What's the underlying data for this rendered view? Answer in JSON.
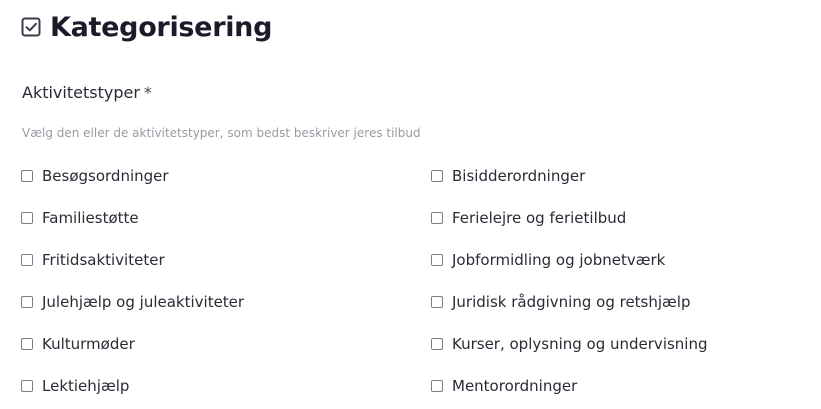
{
  "header": {
    "title": "Kategorisering",
    "icon": "checkbox-checked-icon"
  },
  "field": {
    "label": "Aktivitetstyper",
    "required_mark": "*",
    "helper": "Vælg den eller de aktivitetstyper, som bedst beskriver jeres tilbud"
  },
  "options": {
    "left": [
      {
        "label": "Besøgsordninger",
        "checked": false
      },
      {
        "label": "Familiestøtte",
        "checked": false
      },
      {
        "label": "Fritidsaktiviteter",
        "checked": false
      },
      {
        "label": "Julehjælp og juleaktiviteter",
        "checked": false
      },
      {
        "label": "Kulturmøder",
        "checked": false
      },
      {
        "label": "Lektiehjælp",
        "checked": false
      }
    ],
    "right": [
      {
        "label": "Bisidderordninger",
        "checked": false
      },
      {
        "label": "Ferielejre og ferietilbud",
        "checked": false
      },
      {
        "label": "Jobformidling og jobnetværk",
        "checked": false
      },
      {
        "label": "Juridisk rådgivning og retshjælp",
        "checked": false
      },
      {
        "label": "Kurser, oplysning og undervisning",
        "checked": false
      },
      {
        "label": "Mentorordninger",
        "checked": false
      }
    ]
  }
}
